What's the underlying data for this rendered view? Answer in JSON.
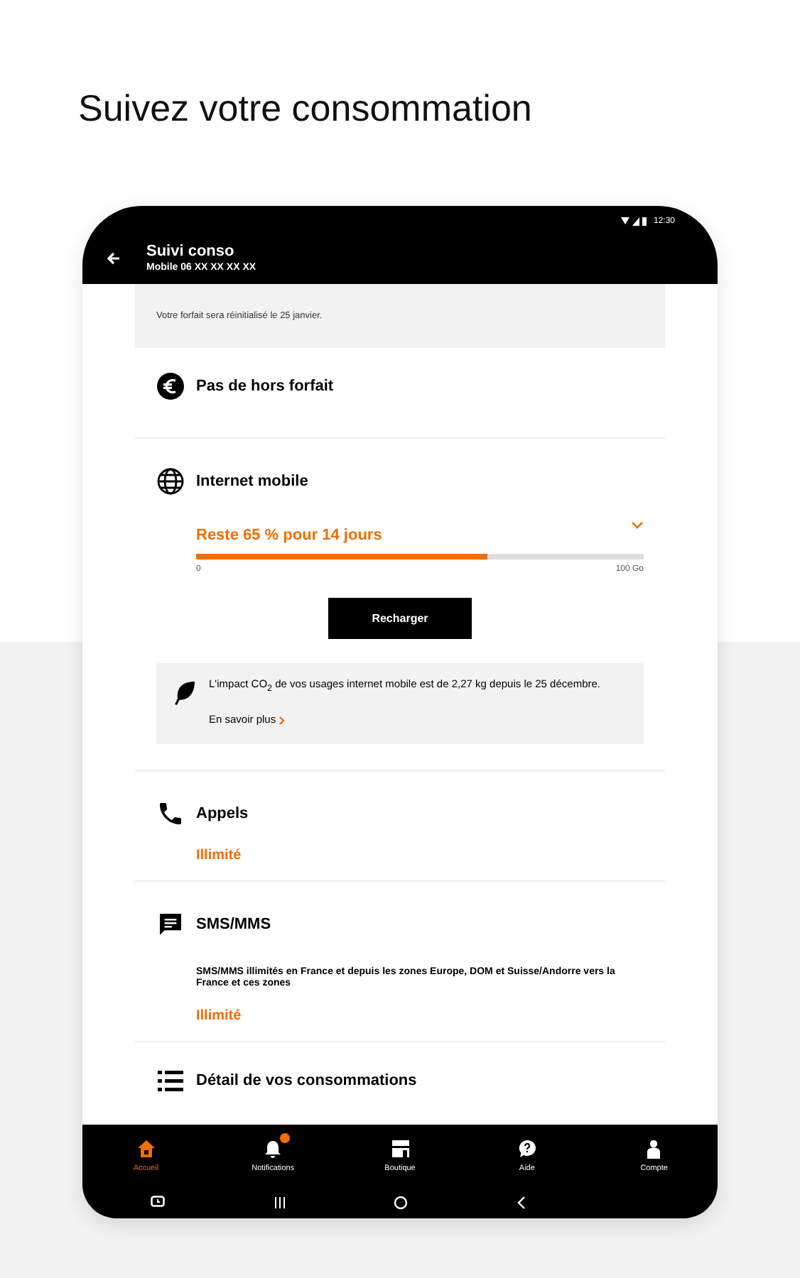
{
  "headline": "Suivez votre consommation",
  "status_bar": {
    "time": "12:30"
  },
  "header": {
    "title": "Suivi conso",
    "subtitle": "Mobile 06 XX XX XX XX"
  },
  "notice": "Votre forfait sera réinitialisé le 25 janvier.",
  "sections": [
    {
      "kind": "title",
      "title": "Pas de hors forfait"
    },
    {
      "kind": "gauge",
      "title": "Internet mobile",
      "remaining": "Reste 65 % pour 14 jours",
      "level": 0.65,
      "scale_min": "0",
      "scale_max": "100 Go",
      "button": "Recharger",
      "eco_text": "L'impact CO$_{2}$ de vos usages internet mobile est de 2,27 kg depuis le 25 décembre.",
      "eco_link": "En savoir plus"
    },
    {
      "kind": "status",
      "title": "Appels",
      "status": "Illimité"
    },
    {
      "kind": "status",
      "title": "SMS/MMS",
      "description": "SMS/MMS illimités en France et depuis les zones Europe, DOM et Suisse/Andorre vers la France et ces zones",
      "status": "Illimité"
    },
    {
      "kind": "title",
      "title": "Détail de vos consommations"
    }
  ],
  "bottom_nav": [
    {
      "label": "Accueil",
      "selected": true,
      "badge": false
    },
    {
      "label": "Notifications",
      "selected": false,
      "badge": true
    },
    {
      "label": "Boutique",
      "selected": false,
      "badge": false
    },
    {
      "label": "Aide",
      "selected": false,
      "badge": false
    },
    {
      "label": "Compte",
      "selected": false,
      "badge": false
    }
  ]
}
